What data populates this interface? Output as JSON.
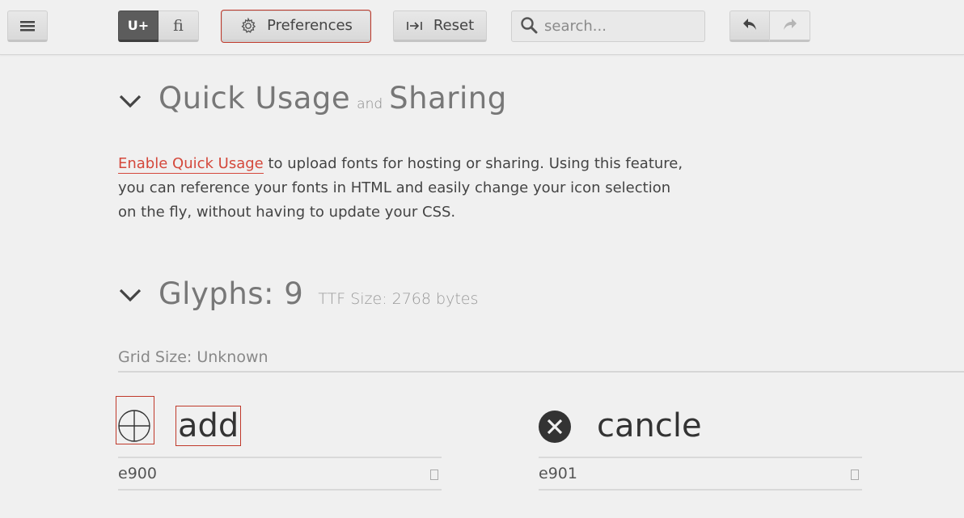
{
  "toolbar": {
    "menu_icon": "hamburger-icon",
    "unicode_toggle_label": "U+",
    "ligature_toggle_label": "fi",
    "preferences_label": "Preferences",
    "preferences_icon": "gear-icon",
    "reset_label": "Reset",
    "reset_icon": "reset-arrow-icon",
    "search_placeholder": "search...",
    "search_icon": "search-icon",
    "undo_icon": "undo-icon",
    "redo_icon": "redo-icon"
  },
  "quick_usage": {
    "title_part1": "Quick Usage",
    "title_joiner": "and",
    "title_part2": "Sharing",
    "link_text": "Enable Quick Usage",
    "description": " to upload fonts for hosting or sharing. Using this feature, you can reference your fonts in HTML and easily change your icon selection on the fly, without having to update your CSS."
  },
  "glyphs_section": {
    "title": "Glyphs: 9",
    "ttf_size": "TTF Size: 2768 bytes",
    "grid_size": "Grid Size: Unknown"
  },
  "glyphs": [
    {
      "name": "add",
      "code": "e900",
      "icon": "circle-plus-icon"
    },
    {
      "name": "cancle",
      "code": "e901",
      "icon": "circle-x-icon"
    }
  ],
  "colors": {
    "accent_link": "#d4483b",
    "highlight_outline": "#c0392b",
    "active_toggle": "#5c5c5c",
    "background": "#f0f0f0"
  }
}
